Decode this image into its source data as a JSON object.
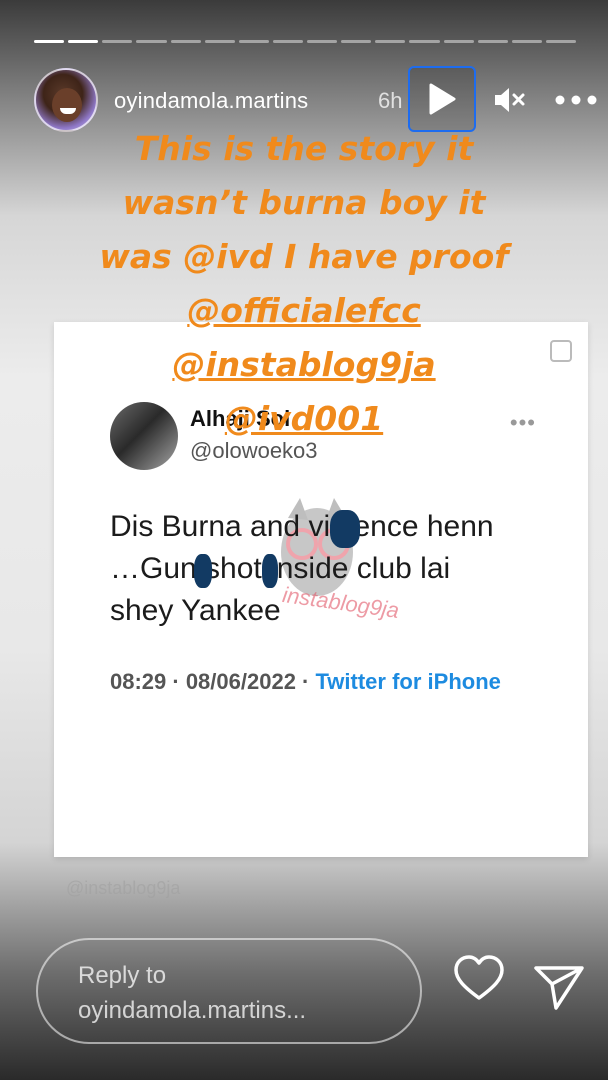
{
  "header": {
    "username": "oyindamola.martins",
    "time": "6h",
    "icons": {
      "play": "play-icon",
      "mute": "mute-icon",
      "more": "more-icon"
    }
  },
  "progress": {
    "segments": 16,
    "completed": 2
  },
  "caption": {
    "lines": [
      "This is the story it",
      "wasn’t burna boy it",
      "was @ivd I have proof"
    ],
    "mentions": [
      "@officialefcc",
      "@instablog9ja",
      "@ivd001"
    ],
    "color": "#f08a1c"
  },
  "tweet": {
    "name": "Alhaji Sol",
    "handle": "@olowoeko3",
    "body_lines": [
      "Dis Burna and violence henn",
      "…Gun shot inside club lai",
      "shey Yankee"
    ],
    "timestamp": "08:29 · 08/06/2022 ·",
    "source": "Twitter for iPhone",
    "more": "•••"
  },
  "watermark": {
    "text": "instablog9ja",
    "footer": "@instablog9ja"
  },
  "reply": {
    "placeholder": "Reply to oyindamola.martins..."
  },
  "icons": {
    "heart": "heart-icon",
    "send": "send-icon",
    "copy": "copy-icon"
  }
}
